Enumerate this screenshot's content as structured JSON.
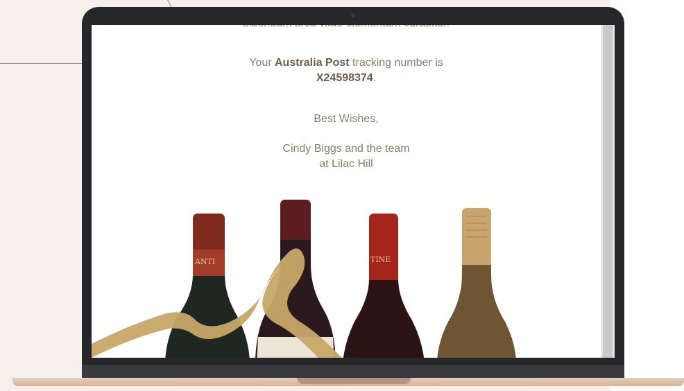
{
  "email": {
    "cut_line": "bibendum arcu vitae elementum curabitur.",
    "tracking_prefix": "Your ",
    "carrier": "Australia Post",
    "tracking_middle": " tracking number is",
    "tracking_number": "X24598374",
    "tracking_suffix": ".",
    "closing": "Best Wishes,",
    "signature_line1": "Cindy Biggs and the team",
    "signature_line2": "at Lilac Hill"
  },
  "colors": {
    "body_text": "#8a7d67",
    "bold_text": "#6b5f4b",
    "background_panel": "#f5f0ea",
    "laptop_bezel": "#26272b",
    "laptop_base": "#e8cdb7"
  },
  "image": {
    "subject": "wine bottles with gold ribbon",
    "bottle_labels": [
      "ANTI",
      "TINE"
    ]
  }
}
